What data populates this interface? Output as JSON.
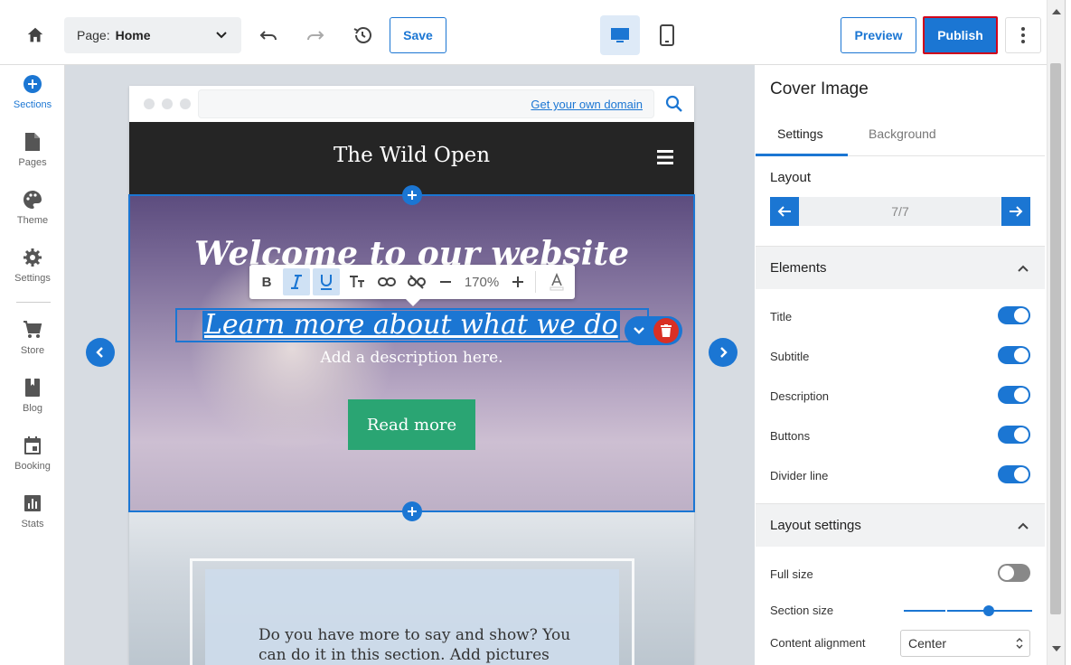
{
  "toolbar": {
    "page_label": "Page:",
    "page_value": "Home",
    "save_label": "Save",
    "preview_label": "Preview",
    "publish_label": "Publish"
  },
  "sidebar": {
    "items": [
      {
        "label": "Sections",
        "icon": "plus-circle-icon",
        "active": true
      },
      {
        "label": "Pages",
        "icon": "page-icon"
      },
      {
        "label": "Theme",
        "icon": "palette-icon"
      },
      {
        "label": "Settings",
        "icon": "gear-icon"
      },
      {
        "label": "Store",
        "icon": "cart-icon"
      },
      {
        "label": "Blog",
        "icon": "book-icon"
      },
      {
        "label": "Booking",
        "icon": "calendar-icon"
      },
      {
        "label": "Stats",
        "icon": "bar-chart-icon"
      }
    ]
  },
  "browser": {
    "domain_link": "Get your own domain"
  },
  "site": {
    "title": "The Wild Open",
    "cover": {
      "title": "Welcome to our website",
      "subtitle": "Learn more about what we do",
      "description": "Add a description here.",
      "button": "Read more"
    },
    "section2_text": "Do you have more to say and show? You can do it in this section. Add pictures"
  },
  "format_toolbar": {
    "zoom": "170%"
  },
  "panel": {
    "title": "Cover Image",
    "tabs": [
      "Settings",
      "Background"
    ],
    "layout_label": "Layout",
    "layout_count": "7/7",
    "elements_label": "Elements",
    "elements": [
      {
        "label": "Title",
        "on": true
      },
      {
        "label": "Subtitle",
        "on": true
      },
      {
        "label": "Description",
        "on": true
      },
      {
        "label": "Buttons",
        "on": true
      },
      {
        "label": "Divider line",
        "on": true
      }
    ],
    "layout_settings_label": "Layout settings",
    "full_size_label": "Full size",
    "full_size_on": false,
    "section_size_label": "Section size",
    "section_size_level": 0.66,
    "content_alignment_label": "Content alignment",
    "content_alignment_value": "Center"
  },
  "colors": {
    "accent": "#1b76d3",
    "publish_border": "#d0021b",
    "cta_green": "#2aa573",
    "delete_red": "#d93025",
    "header_dark": "#252525"
  }
}
